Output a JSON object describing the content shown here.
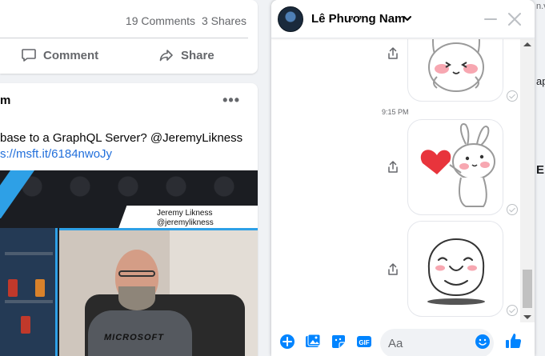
{
  "feed": {
    "top_card": {
      "comments_count": "19 Comments",
      "shares_count": "3 Shares",
      "comment_label": "Comment",
      "share_label": "Share"
    },
    "post": {
      "author_fragment": "m",
      "more_label": "•••",
      "text_fragment": "base to a GraphQL Server? @JeremyLikness",
      "link_fragment": "s://msft.it/6184nwoJy",
      "video_overlay_name": "Jeremy Likness",
      "video_overlay_handle": "@jeremylikness",
      "shirt_text": "MICROSOFT"
    }
  },
  "gutter": {
    "line_1": "n.v",
    "line_2": "ap",
    "line_3": "E"
  },
  "chat": {
    "contact_name": "Lê Phương Nam",
    "messages": [
      {
        "type": "sticker",
        "sticker": "bunny-blushing-hands-on-cheeks-sticker"
      },
      {
        "type": "timestamp",
        "text": "9:15 PM"
      },
      {
        "type": "sticker",
        "sticker": "bunny-holding-red-heart-sticker"
      },
      {
        "type": "sticker",
        "sticker": "smiling-dumpling-blob-sticker"
      }
    ],
    "composer": {
      "placeholder": "Aa"
    }
  },
  "colors": {
    "accent": "#0084ff",
    "icon_blue": "#0084ff",
    "link": "#216fdb",
    "secondary_text": "#65676b",
    "heart": "#e8343c"
  }
}
